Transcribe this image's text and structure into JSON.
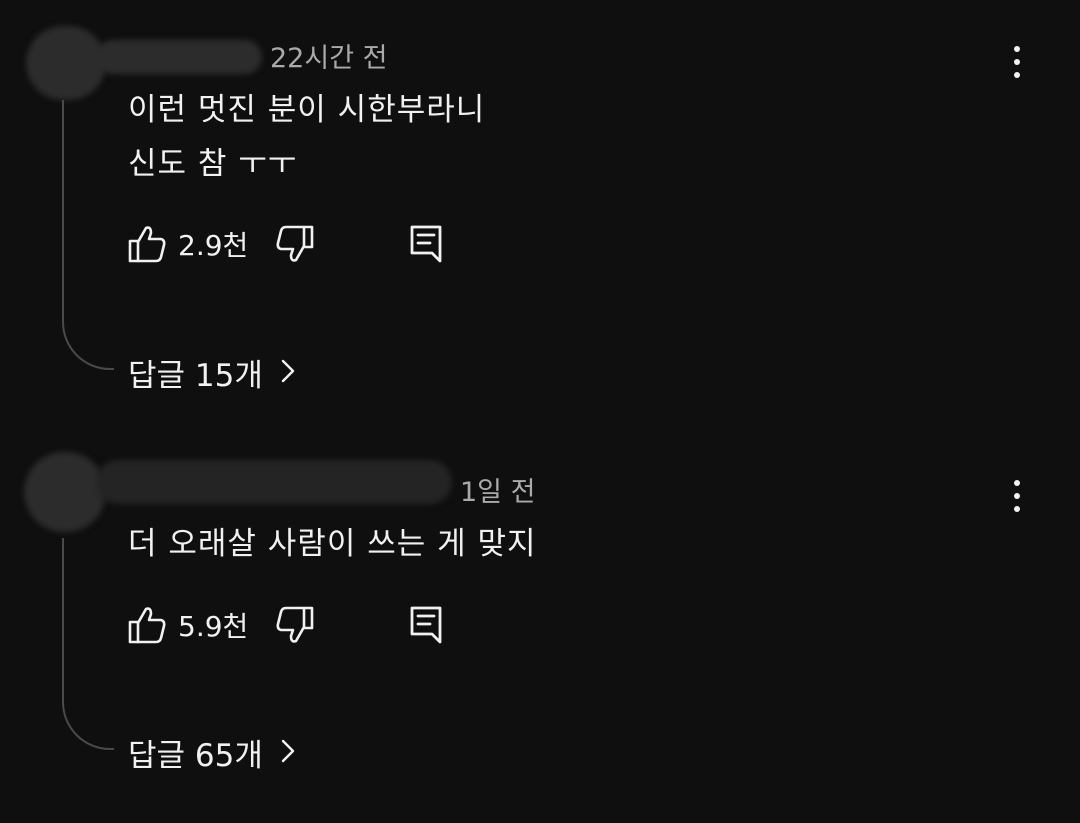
{
  "comments": [
    {
      "time_ago": "22시간 전",
      "text_lines": [
        "이런 멋진 분이 시한부라니",
        "신도 참 ㅜㅜ"
      ],
      "like_count": "2.9천",
      "replies_label": "답글 15개",
      "icons": {
        "like": "thumbs-up-icon",
        "dislike": "thumbs-down-icon",
        "reply": "comment-reply-icon",
        "menu": "more-vertical-icon",
        "chevron": "chevron-right-icon"
      }
    },
    {
      "time_ago": "1일 전",
      "text_lines": [
        "더 오래살 사람이 쓰는 게 맞지"
      ],
      "like_count": "5.9천",
      "replies_label": "답글 65개",
      "icons": {
        "like": "thumbs-up-icon",
        "dislike": "thumbs-down-icon",
        "reply": "comment-reply-icon",
        "menu": "more-vertical-icon",
        "chevron": "chevron-right-icon"
      }
    }
  ],
  "colors": {
    "background": "#0f0f0f",
    "primary_text": "#f1f1f1",
    "secondary_text": "#aaaaaa",
    "thread_line": "#4a4a4a",
    "redaction": "#2c2c2c"
  }
}
